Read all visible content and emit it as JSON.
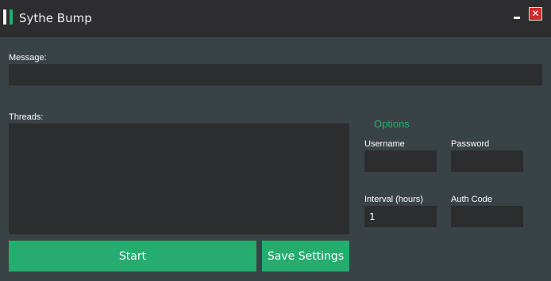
{
  "window": {
    "title": "Sythe Bump",
    "minimize_glyph": "",
    "close_glyph": "✕"
  },
  "message": {
    "label": "Message:",
    "value": ""
  },
  "threads": {
    "label": "Threads:",
    "value": ""
  },
  "options": {
    "title": "Options",
    "username_label": "Username",
    "username_value": "",
    "password_label": "Password",
    "password_value": "",
    "interval_label": "Interval (hours)",
    "interval_value": "1",
    "authcode_label": "Auth Code",
    "authcode_value": ""
  },
  "actions": {
    "start_label": "Start",
    "save_label": "Save Settings"
  },
  "colors": {
    "accent": "#24ad6f",
    "titlebar": "#2d2d30",
    "background": "#394244",
    "field": "#2c2d2f",
    "close": "#d12a2a"
  }
}
